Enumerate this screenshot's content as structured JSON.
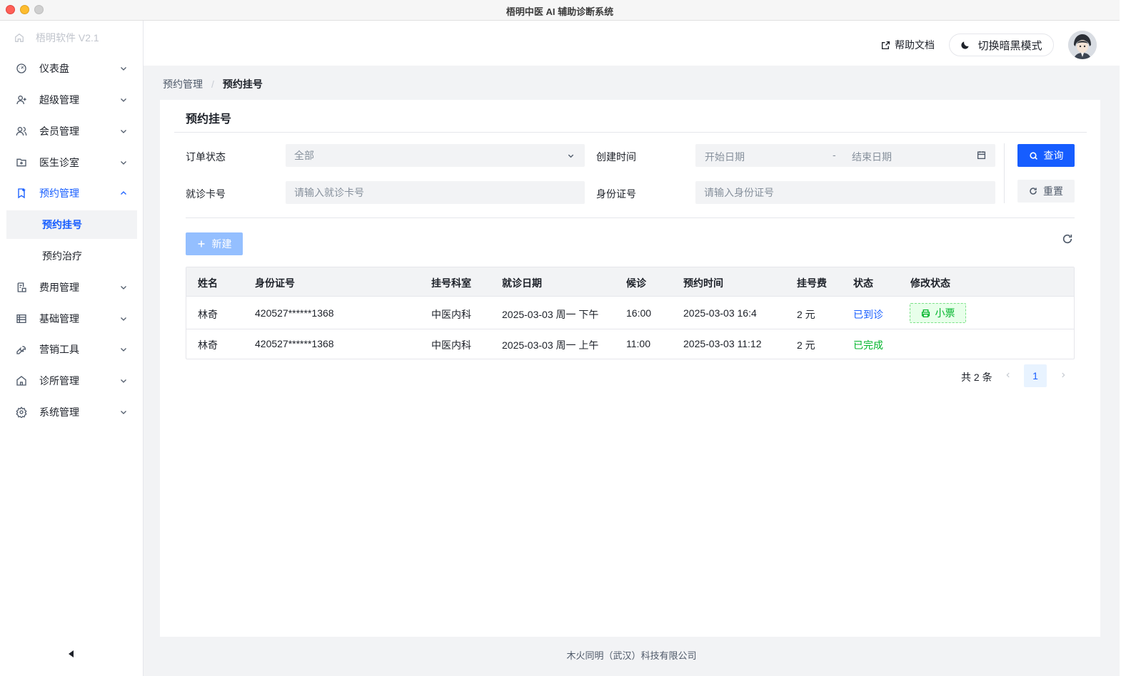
{
  "window": {
    "title": "梧明中医 AI 辅助诊断系统"
  },
  "sidebar": {
    "brand": "梧明软件 V2.1",
    "items": [
      {
        "label": "仪表盘",
        "icon": "dashboard-icon"
      },
      {
        "label": "超级管理",
        "icon": "user-add-icon"
      },
      {
        "label": "会员管理",
        "icon": "user-group-icon"
      },
      {
        "label": "医生诊室",
        "icon": "folder-add-icon"
      },
      {
        "label": "预约管理",
        "icon": "bookmark-icon",
        "expanded": true
      },
      {
        "label": "费用管理",
        "icon": "bill-icon"
      },
      {
        "label": "基础管理",
        "icon": "storage-icon"
      },
      {
        "label": "营销工具",
        "icon": "tool-icon"
      },
      {
        "label": "诊所管理",
        "icon": "home-icon"
      },
      {
        "label": "系统管理",
        "icon": "settings-icon"
      }
    ],
    "subitems": [
      {
        "label": "预约挂号",
        "selected": true
      },
      {
        "label": "预约治疗",
        "selected": false
      }
    ]
  },
  "header": {
    "help_label": "帮助文档",
    "dark_mode_label": "切换暗黑模式"
  },
  "breadcrumb": {
    "parent": "预约管理",
    "current": "预约挂号"
  },
  "card": {
    "title": "预约挂号"
  },
  "filters": {
    "order_status_label": "订单状态",
    "order_status_value": "全部",
    "created_time_label": "创建时间",
    "start_date_placeholder": "开始日期",
    "date_separator": "-",
    "end_date_placeholder": "结束日期",
    "card_no_label": "就诊卡号",
    "card_no_placeholder": "请输入就诊卡号",
    "id_no_label": "身份证号",
    "id_no_placeholder": "请输入身份证号",
    "search_label": "查询",
    "reset_label": "重置"
  },
  "toolbar": {
    "new_label": "新建"
  },
  "table": {
    "headers": [
      "姓名",
      "身份证号",
      "挂号科室",
      "就诊日期",
      "候诊",
      "预约时间",
      "挂号费",
      "状态",
      "修改状态"
    ],
    "rows": [
      {
        "name": "林奇",
        "id_no": "420527******1368",
        "dept": "中医内科",
        "visit_date": "2025-03-03 周一 下午",
        "wait": "16:00",
        "appt_time": "2025-03-03 16:4",
        "fee": "2 元",
        "status": "已到诊",
        "action": "小票"
      },
      {
        "name": "林奇",
        "id_no": "420527******1368",
        "dept": "中医内科",
        "visit_date": "2025-03-03 周一 上午",
        "wait": "11:00",
        "appt_time": "2025-03-03 11:12",
        "fee": "2 元",
        "status": "已完成",
        "action": ""
      }
    ]
  },
  "pagination": {
    "total_label": "共 2 条",
    "current_page": "1"
  },
  "footer": {
    "company": "木火同明（武汉）科技有限公司"
  },
  "colors": {
    "primary": "#165dff",
    "success": "#00b42a",
    "bg": "#f2f3f5"
  }
}
